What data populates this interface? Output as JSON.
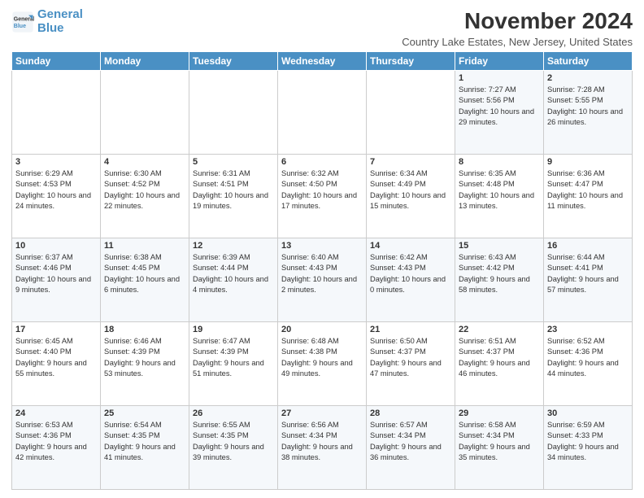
{
  "logo": {
    "line1": "General",
    "line2": "Blue"
  },
  "header": {
    "title": "November 2024",
    "subtitle": "Country Lake Estates, New Jersey, United States"
  },
  "weekdays": [
    "Sunday",
    "Monday",
    "Tuesday",
    "Wednesday",
    "Thursday",
    "Friday",
    "Saturday"
  ],
  "weeks": [
    [
      {
        "day": "",
        "info": ""
      },
      {
        "day": "",
        "info": ""
      },
      {
        "day": "",
        "info": ""
      },
      {
        "day": "",
        "info": ""
      },
      {
        "day": "",
        "info": ""
      },
      {
        "day": "1",
        "info": "Sunrise: 7:27 AM\nSunset: 5:56 PM\nDaylight: 10 hours and 29 minutes."
      },
      {
        "day": "2",
        "info": "Sunrise: 7:28 AM\nSunset: 5:55 PM\nDaylight: 10 hours and 26 minutes."
      }
    ],
    [
      {
        "day": "3",
        "info": "Sunrise: 6:29 AM\nSunset: 4:53 PM\nDaylight: 10 hours and 24 minutes."
      },
      {
        "day": "4",
        "info": "Sunrise: 6:30 AM\nSunset: 4:52 PM\nDaylight: 10 hours and 22 minutes."
      },
      {
        "day": "5",
        "info": "Sunrise: 6:31 AM\nSunset: 4:51 PM\nDaylight: 10 hours and 19 minutes."
      },
      {
        "day": "6",
        "info": "Sunrise: 6:32 AM\nSunset: 4:50 PM\nDaylight: 10 hours and 17 minutes."
      },
      {
        "day": "7",
        "info": "Sunrise: 6:34 AM\nSunset: 4:49 PM\nDaylight: 10 hours and 15 minutes."
      },
      {
        "day": "8",
        "info": "Sunrise: 6:35 AM\nSunset: 4:48 PM\nDaylight: 10 hours and 13 minutes."
      },
      {
        "day": "9",
        "info": "Sunrise: 6:36 AM\nSunset: 4:47 PM\nDaylight: 10 hours and 11 minutes."
      }
    ],
    [
      {
        "day": "10",
        "info": "Sunrise: 6:37 AM\nSunset: 4:46 PM\nDaylight: 10 hours and 9 minutes."
      },
      {
        "day": "11",
        "info": "Sunrise: 6:38 AM\nSunset: 4:45 PM\nDaylight: 10 hours and 6 minutes."
      },
      {
        "day": "12",
        "info": "Sunrise: 6:39 AM\nSunset: 4:44 PM\nDaylight: 10 hours and 4 minutes."
      },
      {
        "day": "13",
        "info": "Sunrise: 6:40 AM\nSunset: 4:43 PM\nDaylight: 10 hours and 2 minutes."
      },
      {
        "day": "14",
        "info": "Sunrise: 6:42 AM\nSunset: 4:43 PM\nDaylight: 10 hours and 0 minutes."
      },
      {
        "day": "15",
        "info": "Sunrise: 6:43 AM\nSunset: 4:42 PM\nDaylight: 9 hours and 58 minutes."
      },
      {
        "day": "16",
        "info": "Sunrise: 6:44 AM\nSunset: 4:41 PM\nDaylight: 9 hours and 57 minutes."
      }
    ],
    [
      {
        "day": "17",
        "info": "Sunrise: 6:45 AM\nSunset: 4:40 PM\nDaylight: 9 hours and 55 minutes."
      },
      {
        "day": "18",
        "info": "Sunrise: 6:46 AM\nSunset: 4:39 PM\nDaylight: 9 hours and 53 minutes."
      },
      {
        "day": "19",
        "info": "Sunrise: 6:47 AM\nSunset: 4:39 PM\nDaylight: 9 hours and 51 minutes."
      },
      {
        "day": "20",
        "info": "Sunrise: 6:48 AM\nSunset: 4:38 PM\nDaylight: 9 hours and 49 minutes."
      },
      {
        "day": "21",
        "info": "Sunrise: 6:50 AM\nSunset: 4:37 PM\nDaylight: 9 hours and 47 minutes."
      },
      {
        "day": "22",
        "info": "Sunrise: 6:51 AM\nSunset: 4:37 PM\nDaylight: 9 hours and 46 minutes."
      },
      {
        "day": "23",
        "info": "Sunrise: 6:52 AM\nSunset: 4:36 PM\nDaylight: 9 hours and 44 minutes."
      }
    ],
    [
      {
        "day": "24",
        "info": "Sunrise: 6:53 AM\nSunset: 4:36 PM\nDaylight: 9 hours and 42 minutes."
      },
      {
        "day": "25",
        "info": "Sunrise: 6:54 AM\nSunset: 4:35 PM\nDaylight: 9 hours and 41 minutes."
      },
      {
        "day": "26",
        "info": "Sunrise: 6:55 AM\nSunset: 4:35 PM\nDaylight: 9 hours and 39 minutes."
      },
      {
        "day": "27",
        "info": "Sunrise: 6:56 AM\nSunset: 4:34 PM\nDaylight: 9 hours and 38 minutes."
      },
      {
        "day": "28",
        "info": "Sunrise: 6:57 AM\nSunset: 4:34 PM\nDaylight: 9 hours and 36 minutes."
      },
      {
        "day": "29",
        "info": "Sunrise: 6:58 AM\nSunset: 4:34 PM\nDaylight: 9 hours and 35 minutes."
      },
      {
        "day": "30",
        "info": "Sunrise: 6:59 AM\nSunset: 4:33 PM\nDaylight: 9 hours and 34 minutes."
      }
    ]
  ]
}
